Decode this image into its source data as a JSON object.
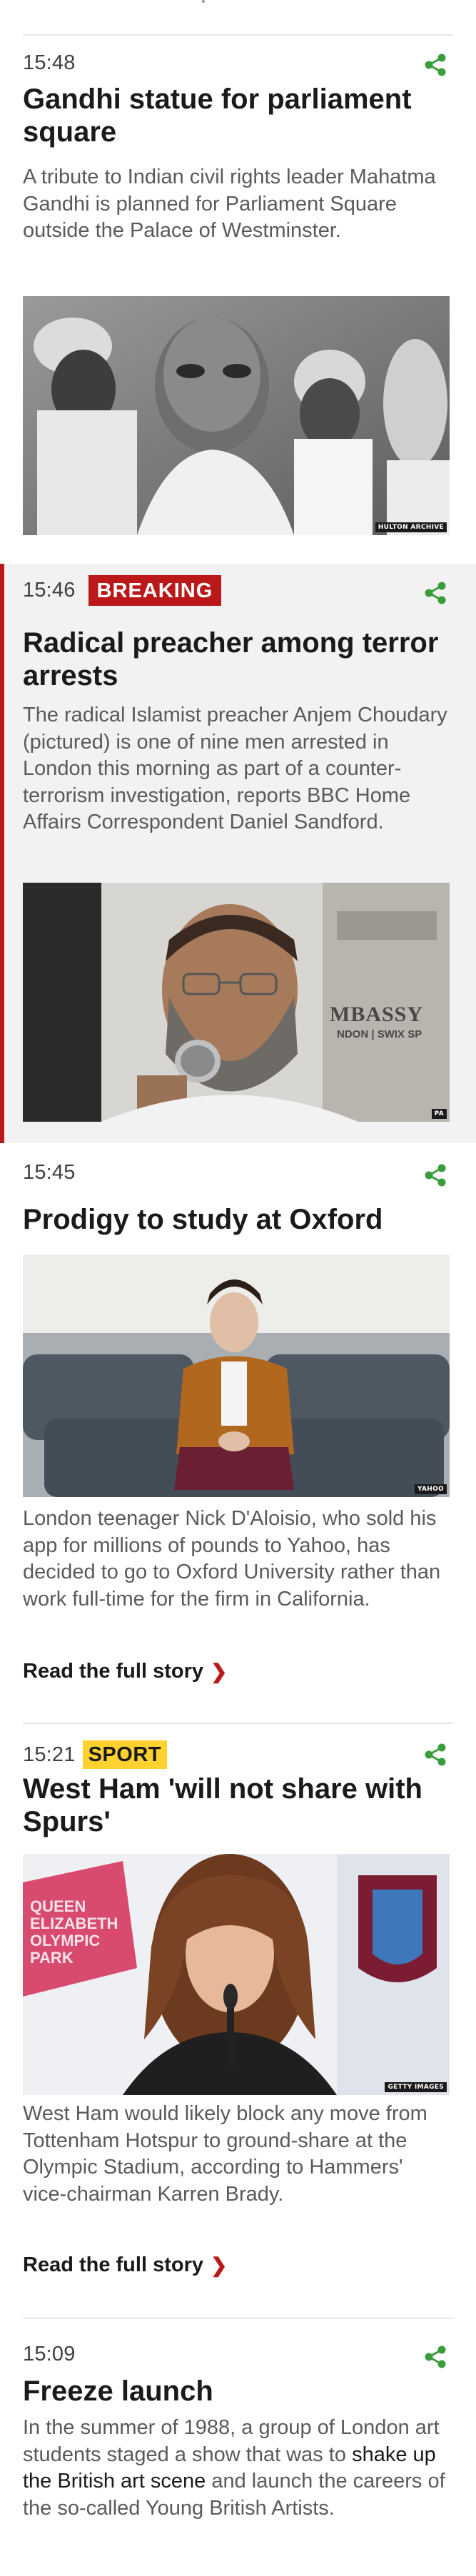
{
  "colors": {
    "accent_red": "#bb1919",
    "share_green": "#3a9c3a",
    "sport_yellow": "#ffd230",
    "breaking_bg": "#f2f2f2"
  },
  "posts": [
    {
      "time": "15:48",
      "headline": "Gandhi statue for parliament square",
      "summary": "A tribute to Indian civil rights leader Mahatma Gandhi is planned for Parliament Square outside the Palace of Westminster.",
      "image_credit": "HULTON ARCHIVE",
      "share_icon": "share-icon"
    },
    {
      "time": "15:46",
      "badge": "BREAKING",
      "headline": "Radical preacher among terror arrests",
      "summary": "The radical Islamist preacher Anjem Choudary (pictured) is one of nine men arrested in London this morning as part of a counter-terrorism investigation, reports BBC Home Affairs Correspondent Daniel Sandford.",
      "image_credit": "PA",
      "image_text": "MBASSY",
      "image_text2": "NDON | SWIX SP",
      "share_icon": "share-icon"
    },
    {
      "time": "15:45",
      "headline": "Prodigy to study at Oxford",
      "summary": "London teenager Nick D'Aloisio, who sold his app for millions of pounds to Yahoo, has decided to go to Oxford University rather than work full-time for the firm in California.",
      "image_credit": "YAHOO",
      "read_more": "Read the full story",
      "share_icon": "share-icon"
    },
    {
      "time": "15:21",
      "badge": "SPORT",
      "headline": "West Ham 'will not share with Spurs'",
      "summary": "West Ham would likely block any move from Tottenham Hotspur to ground-share at the Olympic Stadium, according to Hammers' vice-chairman Karren Brady.",
      "image_credit": "GETTY IMAGES",
      "image_text": "QUEEN ELIZABETH OLYMPIC PARK",
      "read_more": "Read the full story",
      "share_icon": "share-icon"
    },
    {
      "time": "15:09",
      "headline": "Freeze launch",
      "summary_before": "In the summer of 1988, a group of London art students staged a show that was to ",
      "summary_link": "shake up the British art scene",
      "summary_after": " and launch the careers of the so-called Young British Artists.",
      "share_icon": "share-icon"
    }
  ]
}
